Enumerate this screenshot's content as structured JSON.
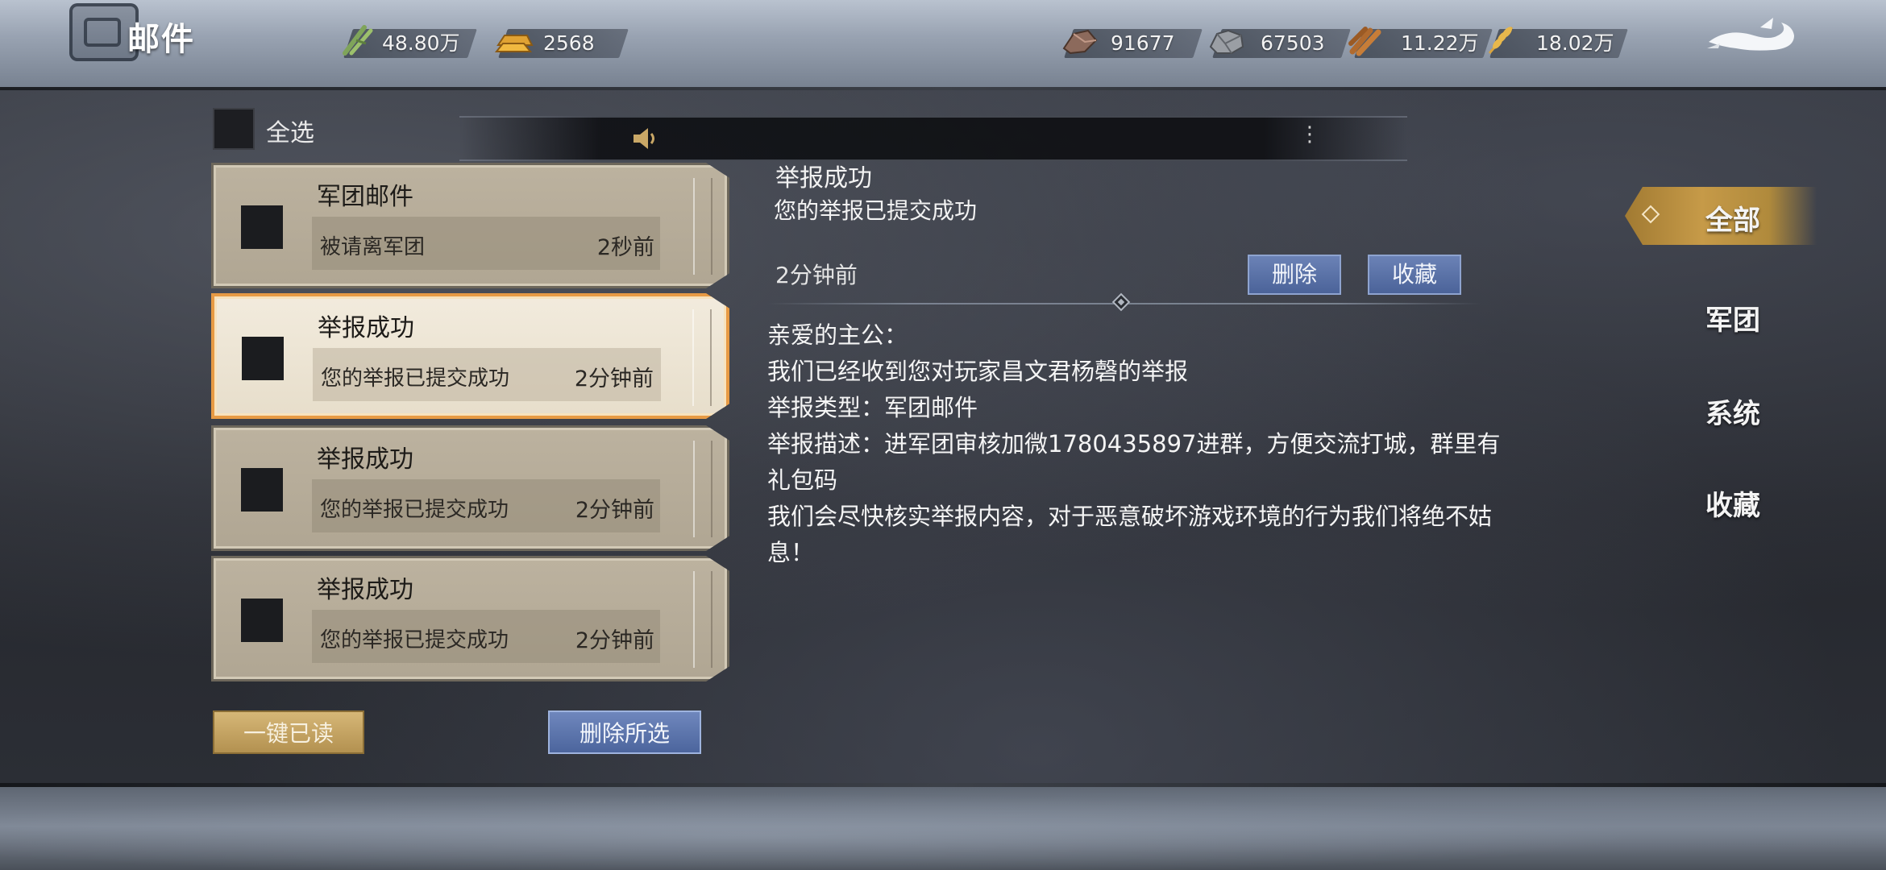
{
  "header": {
    "title": "邮件",
    "resources": [
      {
        "name": "grain",
        "icon": "bamboo-icon",
        "value": "48.80万"
      },
      {
        "name": "gold",
        "icon": "gold-ingot-icon",
        "value": "2568"
      },
      {
        "name": "copper",
        "icon": "copper-ore-icon",
        "value": "91677"
      },
      {
        "name": "stone",
        "icon": "stone-icon",
        "value": "67503"
      },
      {
        "name": "wood",
        "icon": "wood-icon",
        "value": "11.22万"
      },
      {
        "name": "wheat",
        "icon": "wheat-icon",
        "value": "18.02万"
      }
    ],
    "back_icon": "dragon-back-icon"
  },
  "list": {
    "select_all_label": "全选",
    "mails": [
      {
        "title": "军团邮件",
        "preview": "被请离军团",
        "time": "2秒前",
        "selected": false
      },
      {
        "title": "举报成功",
        "preview": "您的举报已提交成功",
        "time": "2分钟前",
        "selected": true
      },
      {
        "title": "举报成功",
        "preview": "您的举报已提交成功",
        "time": "2分钟前",
        "selected": false
      },
      {
        "title": "举报成功",
        "preview": "您的举报已提交成功",
        "time": "2分钟前",
        "selected": false
      }
    ],
    "read_all_label": "一键已读",
    "delete_selected_label": "删除所选"
  },
  "notice": {
    "speaker_icon": "speaker-icon",
    "more_icon": "more-vertical-icon"
  },
  "detail": {
    "title": "举报成功",
    "subtitle": "您的举报已提交成功",
    "time": "2分钟前",
    "delete_label": "删除",
    "favorite_label": "收藏",
    "body": [
      "亲爱的主公：",
      "我们已经收到您对玩家昌文君杨磬的举报",
      "举报类型：军团邮件",
      "举报描述：进军团审核加微1780435897进群，方便交流打城，群里有礼包码",
      "我们会尽快核实举报内容，对于恶意破坏游戏环境的行为我们将绝不姑息！"
    ]
  },
  "tabs": [
    {
      "label": "全部",
      "active": true
    },
    {
      "label": "军团",
      "active": false
    },
    {
      "label": "系统",
      "active": false
    },
    {
      "label": "收藏",
      "active": false
    }
  ],
  "colors": {
    "accent_gold": "#c69a48",
    "button_blue": "#4c659d",
    "selected_border": "#e79a44"
  }
}
